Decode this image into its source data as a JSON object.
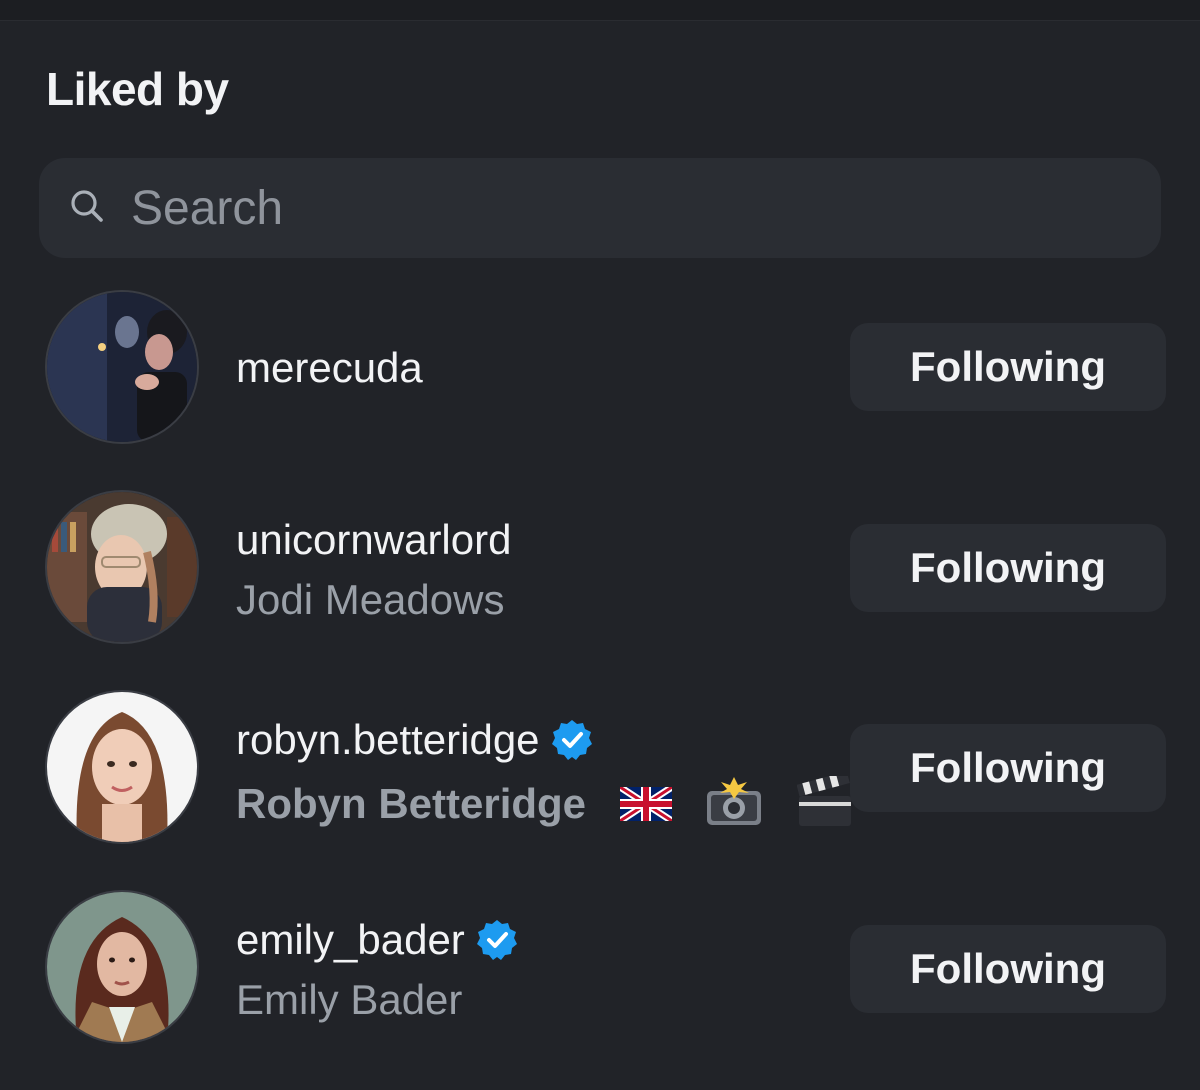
{
  "header": {
    "title": "Liked by"
  },
  "search": {
    "placeholder": "Search",
    "icon": "search-icon"
  },
  "users": [
    {
      "username": "merecuda",
      "full_name": "",
      "verified": false,
      "button_label": "Following"
    },
    {
      "username": "unicornwarlord",
      "full_name": "Jodi Meadows",
      "verified": false,
      "button_label": "Following"
    },
    {
      "username": "robyn.betteridge",
      "full_name": "Robyn Betteridge",
      "name_emojis": [
        "uk-flag-icon",
        "camera-flash-icon",
        "clapper-board-icon"
      ],
      "verified": true,
      "button_label": "Following"
    },
    {
      "username": "emily_bader",
      "full_name": "Emily Bader",
      "verified": true,
      "button_label": "Following"
    }
  ],
  "colors": {
    "background": "#212328",
    "surface": "#2a2d33",
    "verified_blue": "#1d9bf0",
    "secondary_text": "#9aa0a8"
  }
}
